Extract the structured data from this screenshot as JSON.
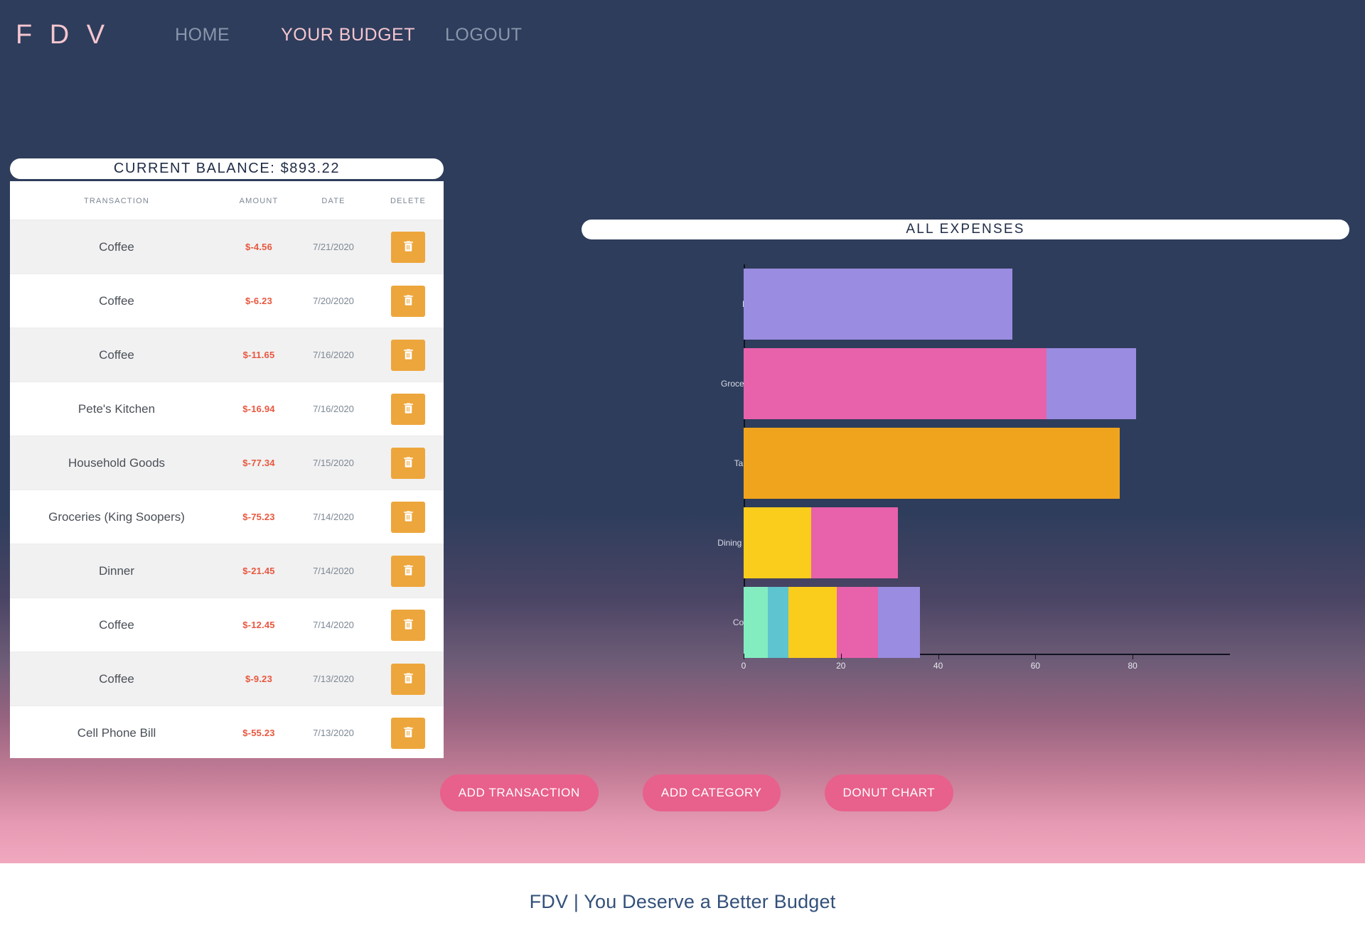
{
  "navbar": {
    "brand": "F D V",
    "links": [
      {
        "label": "HOME",
        "active": false
      },
      {
        "label": "YOUR BUDGET",
        "active": true
      },
      {
        "label": "LOGOUT",
        "active": false
      }
    ]
  },
  "balance": {
    "label": "CURRENT BALANCE: $893.22"
  },
  "table": {
    "headers": [
      "TRANSACTION",
      "AMOUNT",
      "DATE",
      "DELETE"
    ],
    "delete_icon": "trash-icon",
    "rows": [
      {
        "transaction": "Coffee",
        "amount": "$-4.56",
        "date": "7/21/2020"
      },
      {
        "transaction": "Coffee",
        "amount": "$-6.23",
        "date": "7/20/2020"
      },
      {
        "transaction": "Coffee",
        "amount": "$-11.65",
        "date": "7/16/2020"
      },
      {
        "transaction": "Pete's Kitchen",
        "amount": "$-16.94",
        "date": "7/16/2020"
      },
      {
        "transaction": "Household Goods",
        "amount": "$-77.34",
        "date": "7/15/2020"
      },
      {
        "transaction": "Groceries (King Soopers)",
        "amount": "$-75.23",
        "date": "7/14/2020"
      },
      {
        "transaction": "Dinner",
        "amount": "$-21.45",
        "date": "7/14/2020"
      },
      {
        "transaction": "Coffee",
        "amount": "$-12.45",
        "date": "7/14/2020"
      },
      {
        "transaction": "Coffee",
        "amount": "$-9.23",
        "date": "7/13/2020"
      },
      {
        "transaction": "Cell Phone Bill",
        "amount": "$-55.23",
        "date": "7/13/2020"
      }
    ]
  },
  "chart_panel": {
    "title": "ALL EXPENSES"
  },
  "chart_data": {
    "type": "bar",
    "orientation": "horizontal",
    "stacked": true,
    "title": "ALL EXPENSES",
    "xlabel": "",
    "ylabel": "",
    "xlim": [
      0,
      100
    ],
    "xticks": [
      0,
      20,
      40,
      60,
      80
    ],
    "grid": false,
    "legend": "none",
    "categories": [
      "Bills",
      "Groceries",
      "Target",
      "Dining Out",
      "Coffee"
    ],
    "bars": [
      {
        "category": "Bills",
        "total": 55.23,
        "segments": [
          {
            "value": 55.23,
            "color": "#9a8ce0"
          }
        ]
      },
      {
        "category": "Groceries",
        "total": 80.68,
        "segments": [
          {
            "value": 62.33,
            "color": "#e861ab"
          },
          {
            "value": 18.35,
            "color": "#9a8ce0"
          }
        ]
      },
      {
        "category": "Target",
        "total": 77.34,
        "segments": [
          {
            "value": 77.34,
            "color": "#f0a41d"
          }
        ]
      },
      {
        "category": "Dining Out",
        "total": 31.8,
        "segments": [
          {
            "value": 13.9,
            "color": "#facd1c"
          },
          {
            "value": 17.9,
            "color": "#e861ab"
          }
        ]
      },
      {
        "category": "Coffee",
        "total": 36.2,
        "segments": [
          {
            "value": 5.0,
            "color": "#84edc0"
          },
          {
            "value": 4.2,
            "color": "#5ec4cf"
          },
          {
            "value": 10.0,
            "color": "#facd1c"
          },
          {
            "value": 8.5,
            "color": "#e861ab"
          },
          {
            "value": 8.5,
            "color": "#9a8ce0"
          }
        ]
      }
    ]
  },
  "actions": {
    "buttons": [
      {
        "label": "ADD TRANSACTION"
      },
      {
        "label": "ADD CATEGORY"
      },
      {
        "label": "DONUT CHART"
      }
    ]
  },
  "footer": {
    "text": "FDV | You Deserve a Better Budget"
  },
  "colors": {
    "navy": "#2e3d5c",
    "pink_accent": "#e8608c",
    "brand_pink": "#f5c6cf",
    "amount_red": "#e8573f",
    "delete_orange": "#eda63c"
  }
}
